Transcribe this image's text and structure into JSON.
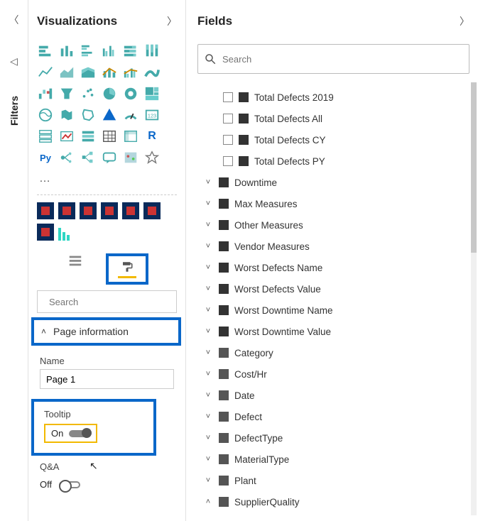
{
  "leftrail": {
    "filters_label": "Filters"
  },
  "viz": {
    "title": "Visualizations",
    "search_placeholder": "Search",
    "page_info_label": "Page information",
    "name_label": "Name",
    "name_value": "Page 1",
    "tooltip_label": "Tooltip",
    "tooltip_state": "On",
    "qa_label": "Q&A",
    "qa_state": "Off"
  },
  "fields": {
    "title": "Fields",
    "search_placeholder": "Search",
    "measures": [
      "Total Defects 2019",
      "Total Defects All",
      "Total Defects CY",
      "Total Defects PY"
    ],
    "measure_groups": [
      "Downtime",
      "Max Measures",
      "Other Measures",
      "Vendor Measures",
      "Worst Defects Name",
      "Worst Defects Value",
      "Worst Downtime Name",
      "Worst Downtime Value"
    ],
    "tables": [
      "Category",
      "Cost/Hr",
      "Date",
      "Defect",
      "DefectType",
      "MaterialType",
      "Plant",
      "SupplierQuality"
    ]
  }
}
